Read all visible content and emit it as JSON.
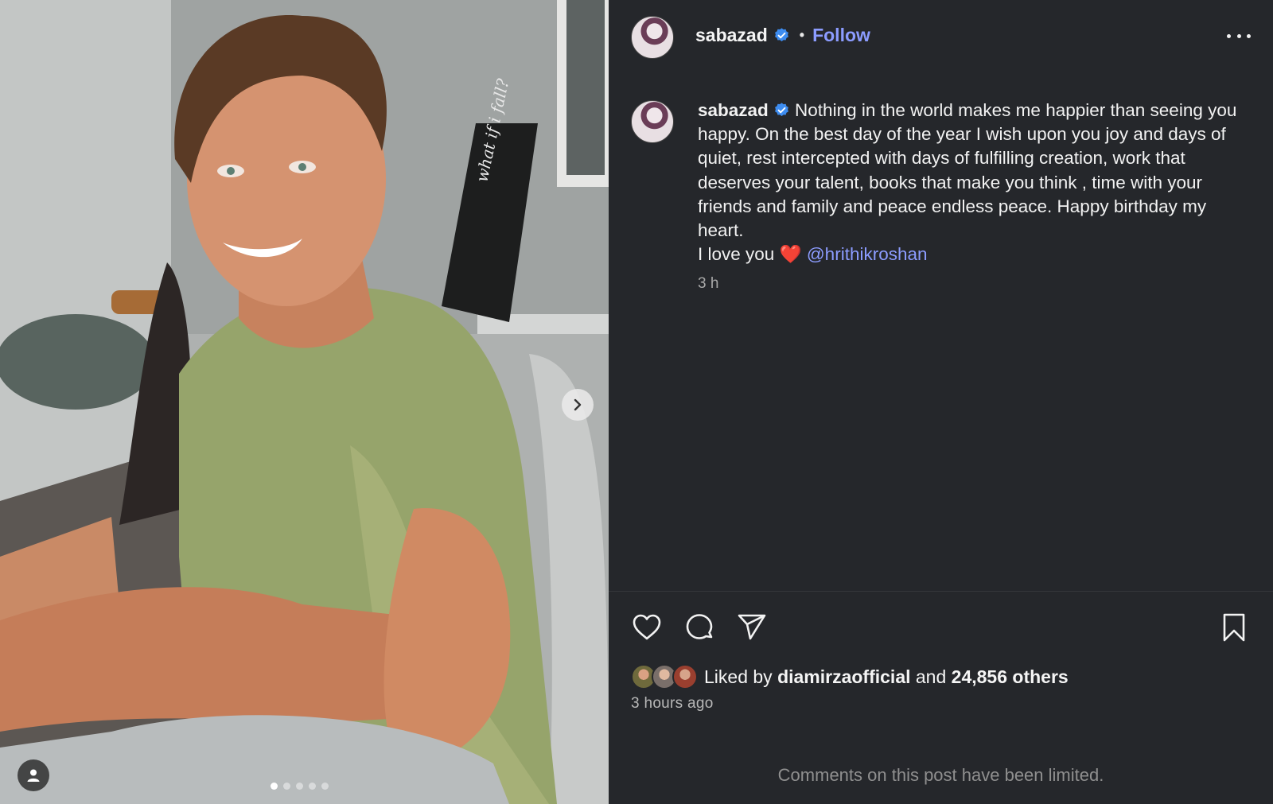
{
  "post": {
    "username": "sabazad",
    "verified": true,
    "separator": "•",
    "follow_label": "Follow",
    "more_icon": "more-horizontal-icon"
  },
  "caption": {
    "username": "sabazad",
    "text": " Nothing in the world makes me happier than seeing you happy. On the best day of the year I wish upon you joy and days of quiet, rest intercepted with days of fulfilling creation, work that deserves your talent, books that make you think , time with your friends and family and peace endless peace. Happy birthday my heart.",
    "love_line": "I love you ",
    "heart": "❤️",
    "mention": "@hrithikroshan",
    "timestamp": "3 h"
  },
  "media": {
    "carousel_count": 5,
    "active_index": 0,
    "next_icon": "chevron-right-icon",
    "tag_icon": "user-tag-icon"
  },
  "actions": {
    "like_icon": "heart-icon",
    "comment_icon": "comment-icon",
    "share_icon": "share-icon",
    "save_icon": "bookmark-icon"
  },
  "likes": {
    "prefix": "Liked by ",
    "first_user": "diamirzaofficial",
    "middle": " and ",
    "others": "24,856 others"
  },
  "time_ago": "3 hours ago",
  "comments_limited": "Comments on this post have been limited.",
  "colors": {
    "background": "#25272b",
    "link": "#8c9cff",
    "verified": "#3d8cf0",
    "muted": "#a8a8a8"
  }
}
